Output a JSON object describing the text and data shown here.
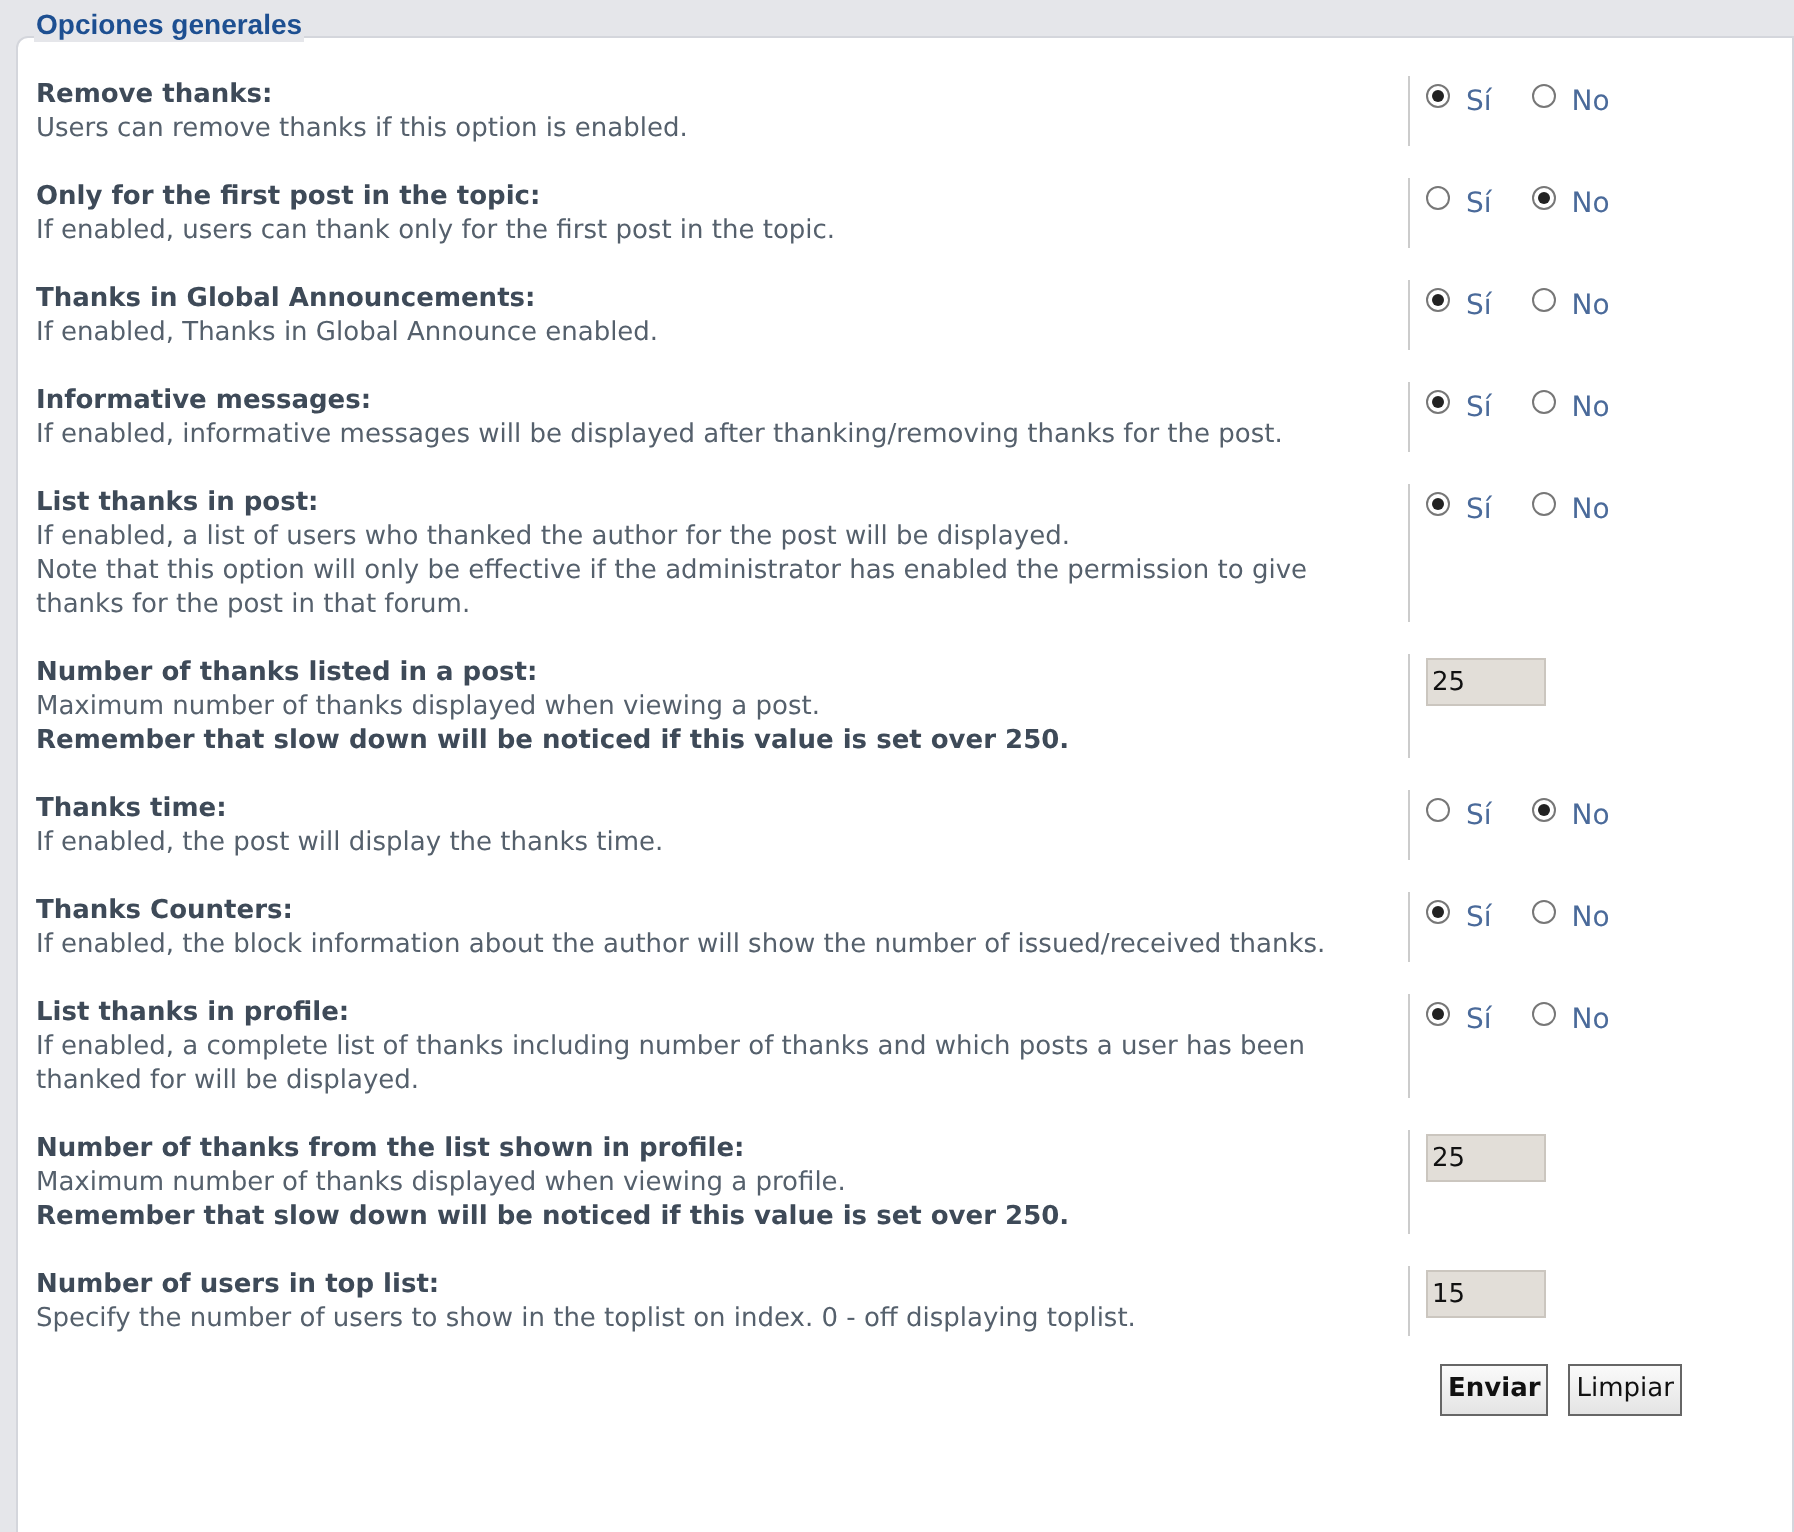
{
  "fieldset": {
    "legend": "Opciones generales"
  },
  "options": [
    {
      "kind": "yesno",
      "title": "Remove thanks:",
      "description": "Users can remove thanks if this option is enabled.",
      "choices": [
        {
          "label": "Sí",
          "selected": true
        },
        {
          "label": "No",
          "selected": false
        }
      ]
    },
    {
      "kind": "yesno",
      "title": "Only for the first post in the topic:",
      "description": "If enabled, users can thank only for the first post in the topic.",
      "choices": [
        {
          "label": "Sí",
          "selected": false
        },
        {
          "label": "No",
          "selected": true
        }
      ]
    },
    {
      "kind": "yesno",
      "title": "Thanks in Global Announcements:",
      "description": "If enabled, Thanks in Global Announce enabled.",
      "choices": [
        {
          "label": "Sí",
          "selected": true
        },
        {
          "label": "No",
          "selected": false
        }
      ]
    },
    {
      "kind": "yesno",
      "title": "Informative messages:",
      "description": "If enabled, informative messages will be displayed after thanking/removing thanks for the post.",
      "choices": [
        {
          "label": "Sí",
          "selected": true
        },
        {
          "label": "No",
          "selected": false
        }
      ]
    },
    {
      "kind": "yesno",
      "title": "List thanks in post:",
      "description": "If enabled, a list of users who thanked the author for the post will be displayed.",
      "note": "Note that this option will only be effective if the administrator has enabled the permission to give thanks for the post in that forum.",
      "choices": [
        {
          "label": "Sí",
          "selected": true
        },
        {
          "label": "No",
          "selected": false
        }
      ]
    },
    {
      "kind": "number",
      "title": "Number of thanks listed in a post:",
      "description": "Maximum number of thanks displayed when viewing a post.",
      "warning": "Remember that slow down will be noticed if this value is set over 250.",
      "value": "25"
    },
    {
      "kind": "yesno",
      "title": "Thanks time:",
      "description": "If enabled, the post will display the thanks time.",
      "choices": [
        {
          "label": "Sí",
          "selected": false
        },
        {
          "label": "No",
          "selected": true
        }
      ]
    },
    {
      "kind": "yesno",
      "title": "Thanks Counters:",
      "description": "If enabled, the block information about the author will show the number of issued/received thanks.",
      "choices": [
        {
          "label": "Sí",
          "selected": true
        },
        {
          "label": "No",
          "selected": false
        }
      ]
    },
    {
      "kind": "yesno",
      "title": "List thanks in profile:",
      "description": "If enabled, a complete list of thanks including number of thanks and which posts a user has been thanked for will be displayed.",
      "choices": [
        {
          "label": "Sí",
          "selected": true
        },
        {
          "label": "No",
          "selected": false
        }
      ]
    },
    {
      "kind": "number",
      "title": "Number of thanks from the list shown in profile:",
      "description": "Maximum number of thanks displayed when viewing a profile.",
      "warning": "Remember that slow down will be noticed if this value is set over 250.",
      "value": "25"
    },
    {
      "kind": "number",
      "title": "Number of users in top list:",
      "description": "Specify the number of users to show in the toplist on index. 0 - off displaying toplist.",
      "value": "15"
    }
  ],
  "buttons": [
    {
      "kind": "submit",
      "label": "Enviar"
    },
    {
      "kind": "reset",
      "label": "Limpiar"
    }
  ]
}
